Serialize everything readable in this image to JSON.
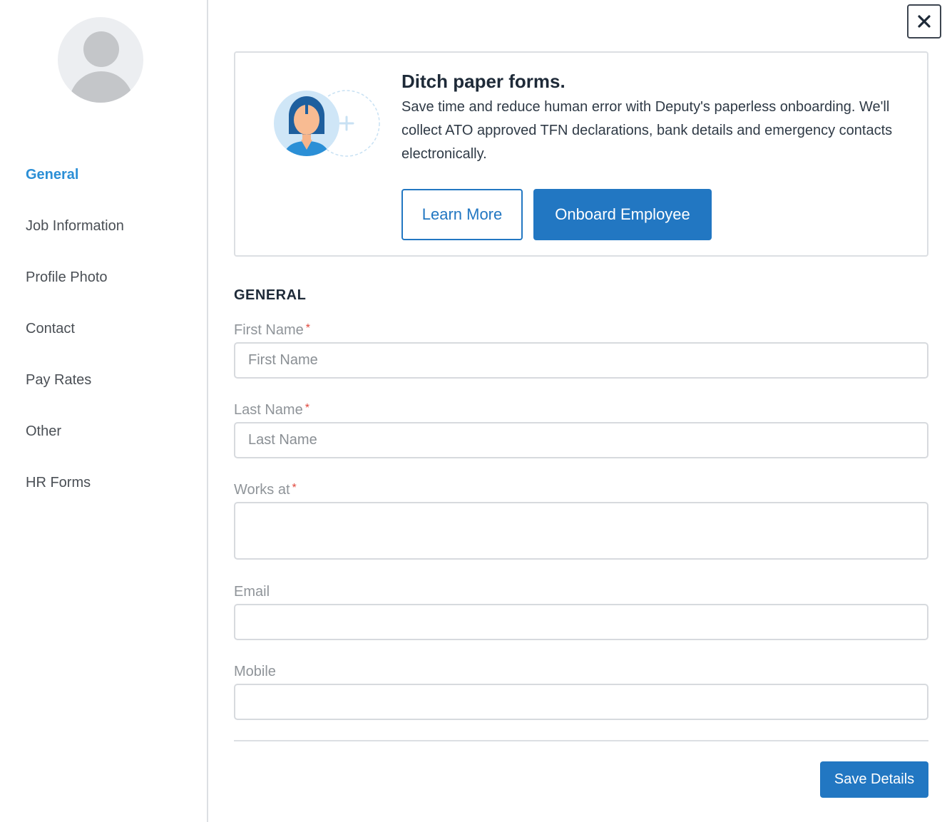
{
  "sidebar": {
    "items": [
      {
        "label": "General"
      },
      {
        "label": "Job Information"
      },
      {
        "label": "Profile Photo"
      },
      {
        "label": "Contact"
      },
      {
        "label": "Pay Rates"
      },
      {
        "label": "Other"
      },
      {
        "label": "HR Forms"
      }
    ],
    "active_item": "General"
  },
  "close_icon": "close-icon",
  "promo": {
    "title": "Ditch paper forms.",
    "text": "Save time and reduce human error with Deputy's paperless onboarding. We'll collect ATO approved TFN declarations, bank details and emergency contacts electronically.",
    "learn_more_label": "Learn More",
    "onboard_label": "Onboard Employee",
    "illustration": "employee-add-illustration"
  },
  "form": {
    "section_title": "GENERAL",
    "fields": {
      "first_name": {
        "label": "First Name",
        "required_marker": "*",
        "placeholder": "First Name",
        "value": ""
      },
      "last_name": {
        "label": "Last Name",
        "required_marker": "*",
        "placeholder": "Last Name",
        "value": ""
      },
      "works_at": {
        "label": "Works at",
        "required_marker": "*",
        "value": ""
      },
      "email": {
        "label": "Email",
        "value": ""
      },
      "mobile": {
        "label": "Mobile",
        "value": ""
      }
    },
    "save_label": "Save Details"
  },
  "colors": {
    "accent": "#2277c2",
    "active_nav": "#2b8fd6",
    "required": "#e0473c",
    "border": "#dcdfe3"
  }
}
